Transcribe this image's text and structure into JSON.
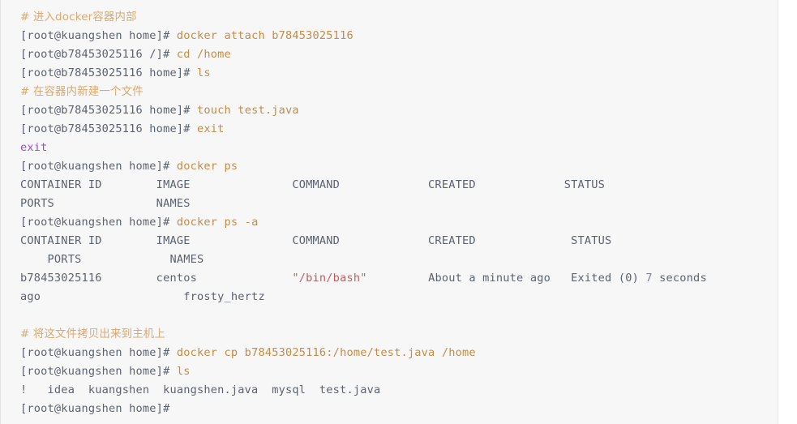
{
  "terminal": {
    "theme": {
      "background": "#f7f7f7",
      "page_background": "#ffffff",
      "prompt_color": "#5b6370",
      "command_color": "#c68b45",
      "comment_color": "#dba96f",
      "output_color": "#5b6370",
      "exit_color": "#9b4dca",
      "string_color": "#bf5c5c",
      "number_color": "#7c8594"
    },
    "lines": [
      {
        "id": "comment-enter-container",
        "kind": "comment",
        "segments": [
          {
            "style": "comment",
            "text": "# 进入docker容器内部",
            "cjk": true
          }
        ]
      },
      {
        "id": "cmd-docker-attach",
        "kind": "command",
        "segments": [
          {
            "style": "prompt",
            "text": "[root@kuangshen home]# "
          },
          {
            "style": "command",
            "text": "docker attach b78453025116"
          }
        ]
      },
      {
        "id": "cmd-cd-home",
        "kind": "command",
        "segments": [
          {
            "style": "prompt",
            "text": "[root@b78453025116 /]# "
          },
          {
            "style": "command",
            "text": "cd /home"
          }
        ]
      },
      {
        "id": "cmd-ls-in-container",
        "kind": "command",
        "segments": [
          {
            "style": "prompt",
            "text": "[root@b78453025116 home]# "
          },
          {
            "style": "command",
            "text": "ls"
          }
        ]
      },
      {
        "id": "comment-new-file",
        "kind": "comment",
        "segments": [
          {
            "style": "comment",
            "text": "# 在容器内新建一个文件",
            "cjk": true
          }
        ]
      },
      {
        "id": "cmd-touch-testjava",
        "kind": "command",
        "segments": [
          {
            "style": "prompt",
            "text": "[root@b78453025116 home]# "
          },
          {
            "style": "command",
            "text": "touch test.java"
          }
        ]
      },
      {
        "id": "cmd-exit",
        "kind": "command",
        "segments": [
          {
            "style": "prompt",
            "text": "[root@b78453025116 home]# "
          },
          {
            "style": "command",
            "text": "exit"
          }
        ]
      },
      {
        "id": "out-exit",
        "kind": "output",
        "segments": [
          {
            "style": "exit",
            "text": "exit"
          }
        ]
      },
      {
        "id": "cmd-docker-ps",
        "kind": "command",
        "segments": [
          {
            "style": "prompt",
            "text": "[root@kuangshen home]# "
          },
          {
            "style": "command",
            "text": "docker ps"
          }
        ]
      },
      {
        "id": "out-ps-header-1",
        "kind": "output",
        "segments": [
          {
            "style": "output",
            "text": "CONTAINER ID        IMAGE               COMMAND             CREATED             STATUS"
          }
        ]
      },
      {
        "id": "out-ps-header-2",
        "kind": "output",
        "segments": [
          {
            "style": "output",
            "text": "PORTS               NAMES"
          }
        ]
      },
      {
        "id": "cmd-docker-ps-a",
        "kind": "command",
        "segments": [
          {
            "style": "prompt",
            "text": "[root@kuangshen home]# "
          },
          {
            "style": "command",
            "text": "docker ps -a"
          }
        ]
      },
      {
        "id": "out-psa-header-1",
        "kind": "output",
        "segments": [
          {
            "style": "output",
            "text": "CONTAINER ID        IMAGE               COMMAND             CREATED              STATUS"
          }
        ]
      },
      {
        "id": "out-psa-header-2",
        "kind": "output",
        "segments": [
          {
            "style": "output",
            "text": "    PORTS             NAMES"
          }
        ]
      },
      {
        "id": "out-psa-row-1",
        "kind": "output",
        "segments": [
          {
            "style": "output",
            "text": "b78453025116        centos              "
          },
          {
            "style": "string",
            "text": "\"/bin/bash\""
          },
          {
            "style": "output",
            "text": "         About a minute ago   Exited (0) "
          },
          {
            "style": "number",
            "text": "7"
          },
          {
            "style": "output",
            "text": " seconds"
          }
        ]
      },
      {
        "id": "out-psa-row-1-cont",
        "kind": "output",
        "segments": [
          {
            "style": "output",
            "text": "ago                     frosty_hertz"
          }
        ]
      },
      {
        "id": "spacer-1",
        "kind": "blank",
        "segments": [
          {
            "style": "output",
            "text": " "
          }
        ]
      },
      {
        "id": "comment-copy-to-host",
        "kind": "comment",
        "segments": [
          {
            "style": "comment",
            "text": "# 将这文件拷贝出来到主机上",
            "cjk": true
          }
        ]
      },
      {
        "id": "cmd-docker-cp",
        "kind": "command",
        "segments": [
          {
            "style": "prompt",
            "text": "[root@kuangshen home]# "
          },
          {
            "style": "command",
            "text": "docker cp b78453025116:/home/test.java /home"
          }
        ]
      },
      {
        "id": "cmd-ls-host",
        "kind": "command",
        "segments": [
          {
            "style": "prompt",
            "text": "[root@kuangshen home]# "
          },
          {
            "style": "command",
            "text": "ls"
          }
        ]
      },
      {
        "id": "out-ls-host",
        "kind": "output",
        "segments": [
          {
            "style": "output",
            "text": "!   idea  kuangshen  kuangshen.java  mysql  test.java"
          }
        ]
      },
      {
        "id": "cmd-final-prompt",
        "kind": "command",
        "segments": [
          {
            "style": "prompt",
            "text": "[root@kuangshen home]#"
          }
        ]
      }
    ]
  }
}
